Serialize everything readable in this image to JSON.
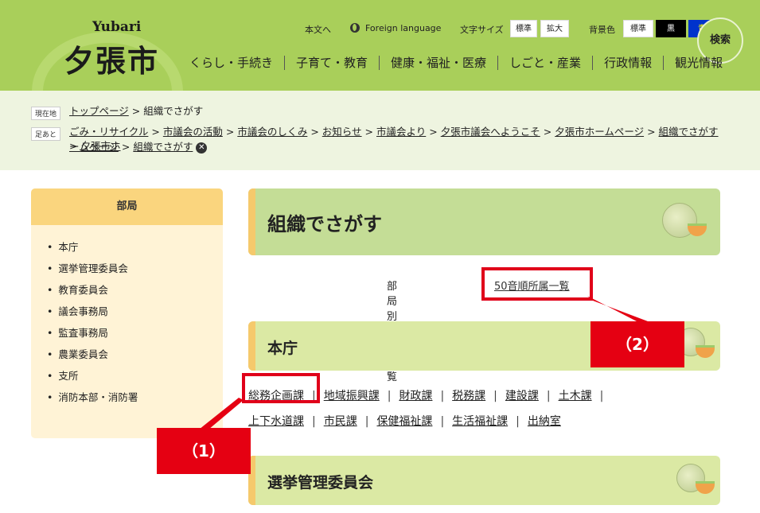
{
  "header": {
    "logo_roman": "Yubari",
    "logo_kanji": "夕張市",
    "skip_link": "本文へ",
    "foreign_language": "Foreign language",
    "font_size_label": "文字サイズ",
    "font_size_options": [
      "標準",
      "拡大"
    ],
    "bg_color_label": "背景色",
    "bg_color_options": [
      "標準",
      "黒",
      "青"
    ],
    "search": "検索",
    "nav": [
      "くらし・手続き",
      "子育て・教育",
      "健康・福祉・医療",
      "しごと・産業",
      "行政情報",
      "観光情報"
    ]
  },
  "breadcrumb": {
    "current_tag": "現在地",
    "current": [
      "トップページ",
      "組織でさがす"
    ],
    "history_tag": "足あと",
    "history_line1": [
      "ごみ・リサイクル",
      "市議会の活動",
      "市議会のしくみ",
      "お知らせ",
      "市議会より",
      "夕張市議会へようこそ",
      "夕張市ホームページ",
      "組織でさがす",
      "夕張市ホ"
    ],
    "history_line2": [
      "ームページ",
      "組織でさがす"
    ],
    "separator": ">"
  },
  "sidebar": {
    "title": "部局",
    "items": [
      "本庁",
      "選挙管理委員会",
      "教育委員会",
      "議会事務局",
      "監査事務局",
      "農業委員会",
      "支所",
      "消防本部・消防署"
    ]
  },
  "main": {
    "page_title": "組織でさがす",
    "tab_by_dept": "部局別所属一覧",
    "tab_by_kana": "50音順所属一覧",
    "section1_title": "本庁",
    "section1_links_row1": [
      "総務企画課",
      "地域振興課",
      "財政課",
      "税務課",
      "建設課",
      "土木課"
    ],
    "section1_links_row2": [
      "上下水道課",
      "市民課",
      "保健福祉課",
      "生活福祉課",
      "出納室"
    ],
    "section2_title": "選挙管理委員会"
  },
  "annotations": {
    "label1": "（1）",
    "label2": "（2）"
  },
  "colors": {
    "header_green": "#a9cf5a",
    "band_green": "#c4dd96",
    "accent_yellow": "#f5c96c",
    "annotation_red": "#e50012"
  }
}
